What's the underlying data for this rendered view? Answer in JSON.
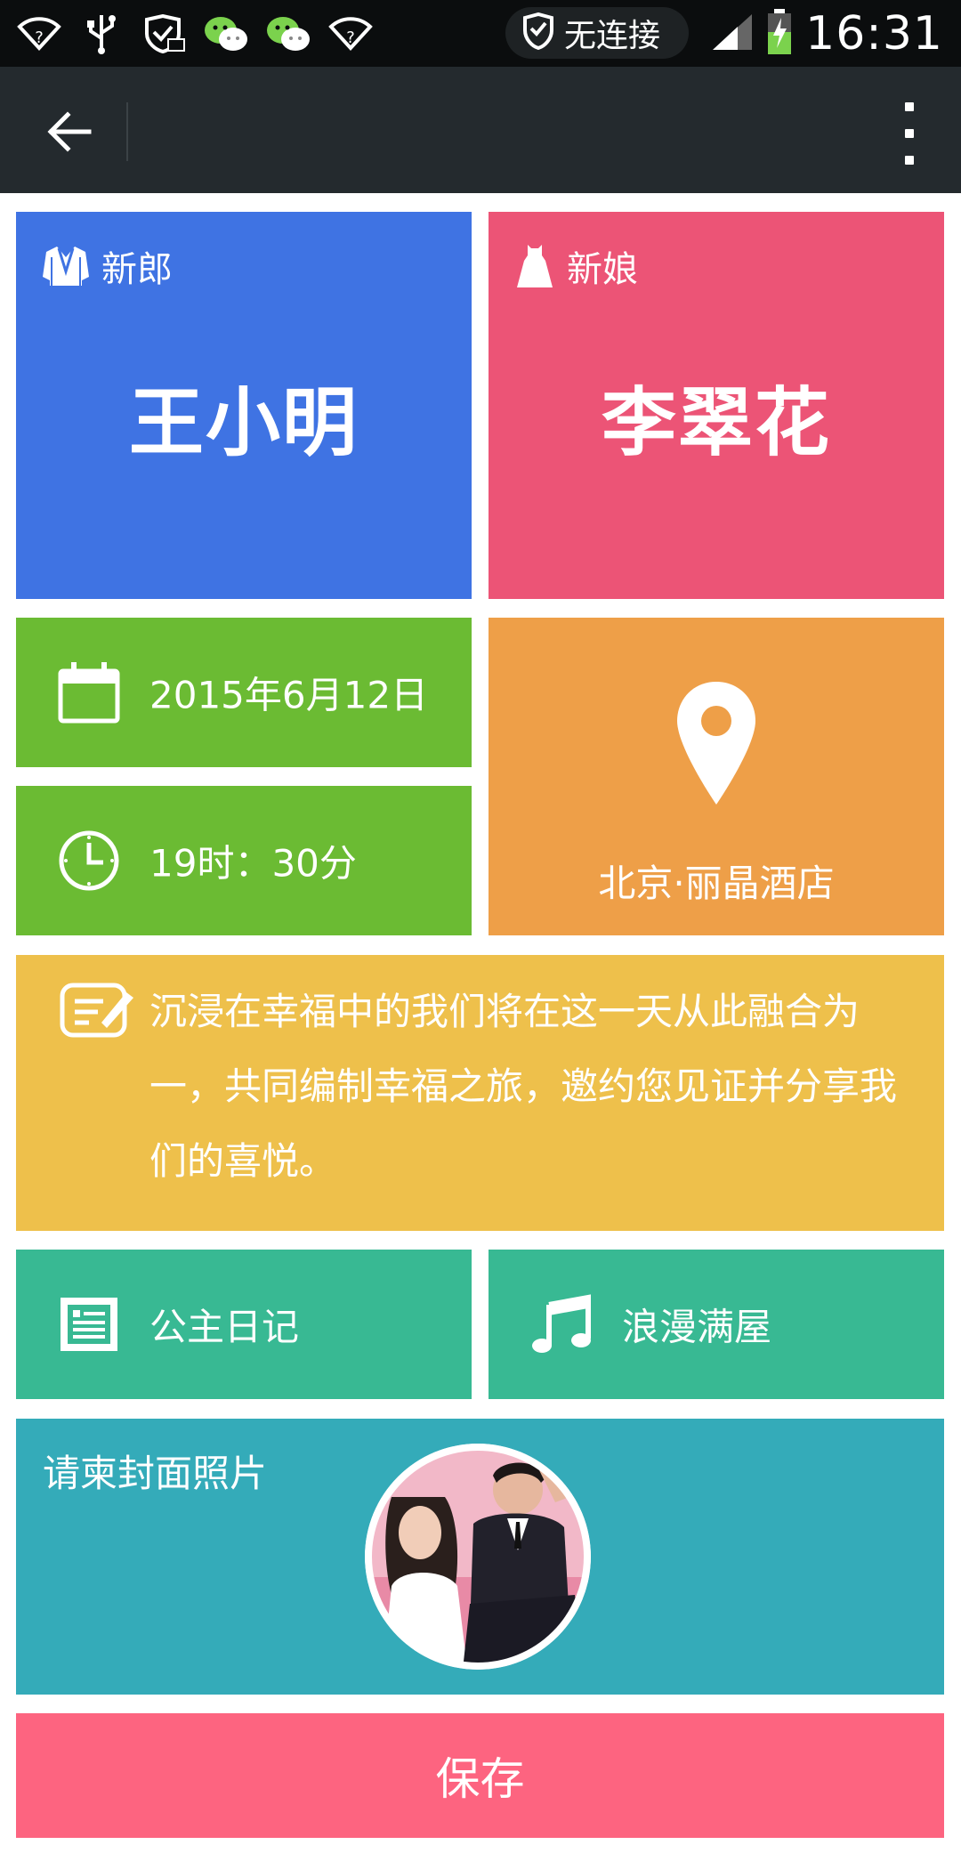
{
  "status_bar": {
    "network_label": "无连接",
    "time": "16:31",
    "icons": [
      "wifi-question-icon",
      "usb-icon",
      "shield-mail-icon",
      "wechat-icon",
      "wechat-icon",
      "wifi-question-icon",
      "shield-icon",
      "signal-icon",
      "battery-charging-icon"
    ]
  },
  "toolbar": {
    "back_icon": "arrow-left-icon",
    "more_icon": "more-vertical-icon"
  },
  "groom": {
    "role": "新郎",
    "name": "王小明",
    "icon": "suit-icon",
    "color": "#3f73e3"
  },
  "bride": {
    "role": "新娘",
    "name": "李翠花",
    "icon": "dress-icon",
    "color": "#ec5476"
  },
  "date": {
    "text": "2015年6月12日",
    "icon": "calendar-icon",
    "color": "#6bbb33"
  },
  "time": {
    "text": "19时：30分",
    "icon": "clock-icon",
    "color": "#6bbb33"
  },
  "place": {
    "text": "北京·丽晶酒店",
    "icon": "location-pin-icon",
    "color": "#ee9f48"
  },
  "message": {
    "text": "沉浸在幸福中的我们将在这一天从此融合为一，共同编制幸福之旅，邀约您见证并分享我们的喜悦。",
    "icon": "edit-note-icon",
    "color": "#eec04b"
  },
  "diary": {
    "label": "公主日记",
    "icon": "newspaper-icon",
    "color": "#38b993"
  },
  "music": {
    "label": "浪漫满屋",
    "icon": "music-note-icon",
    "color": "#38b993"
  },
  "cover": {
    "label": "请柬封面照片",
    "color": "#34abb9"
  },
  "save": {
    "label": "保存",
    "color": "#fd6480"
  }
}
